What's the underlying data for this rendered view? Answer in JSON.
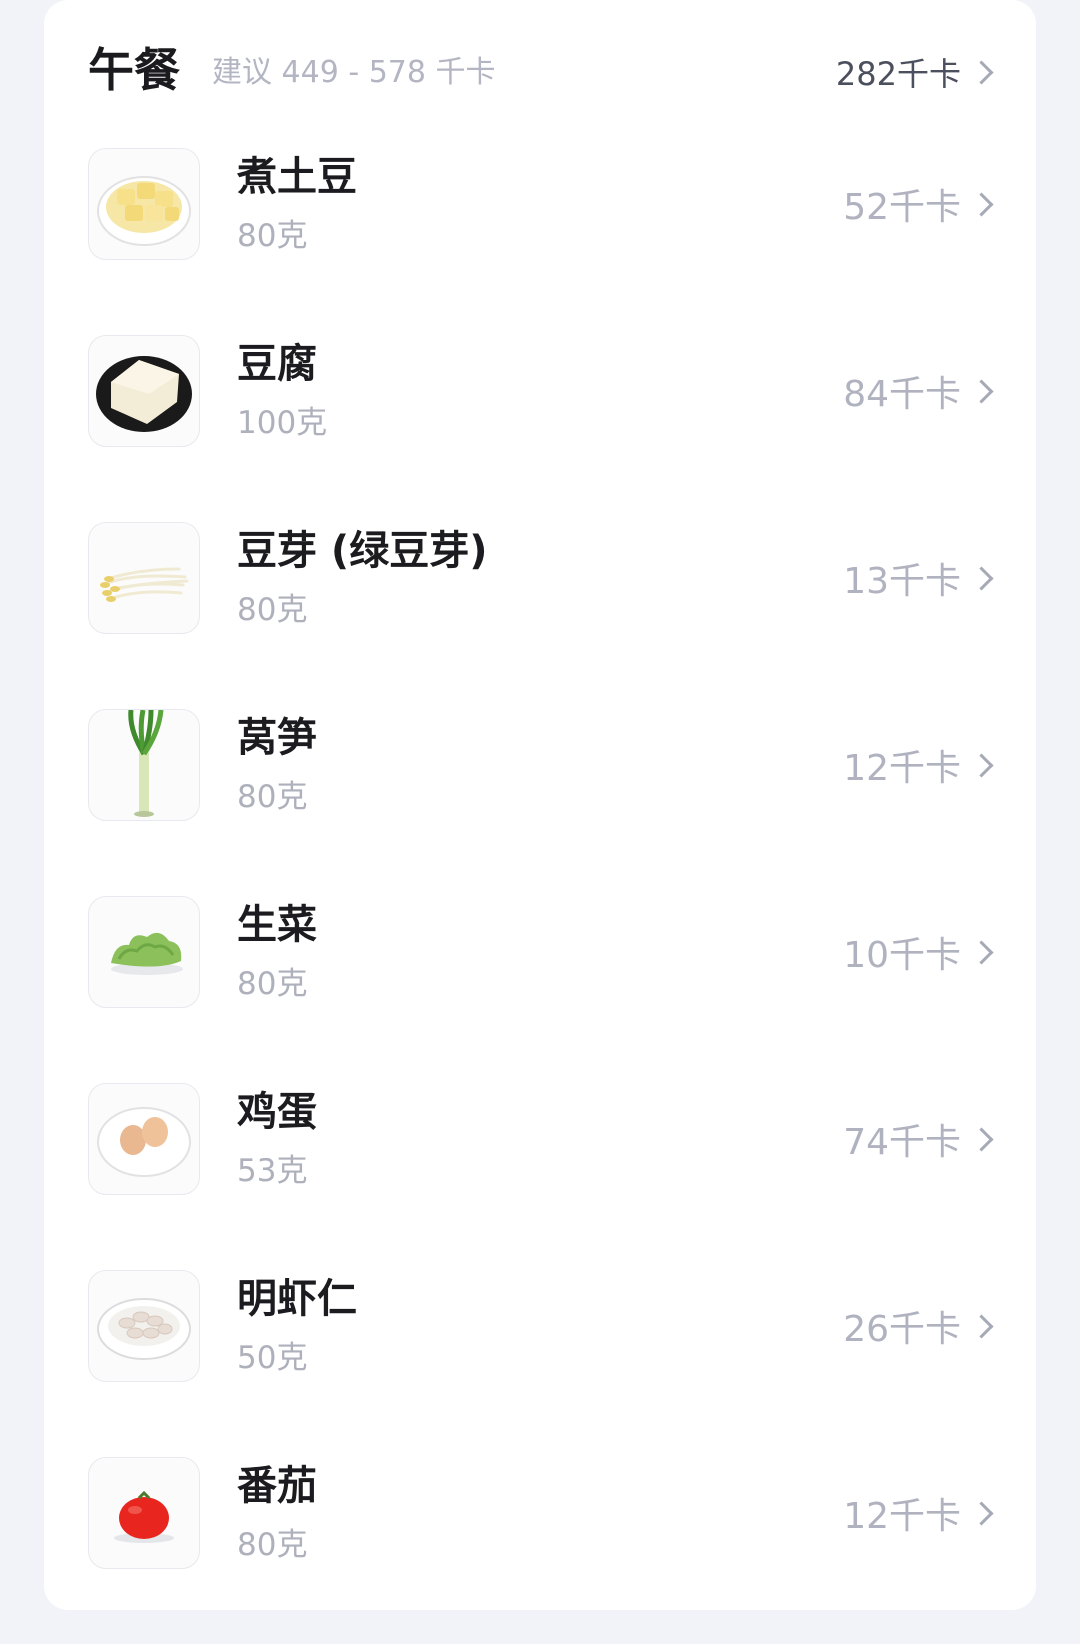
{
  "meal": {
    "title": "午餐",
    "suggestion": "建议 449 - 578 千卡",
    "total_kcal": "282千卡"
  },
  "items": [
    {
      "name": "煮土豆",
      "weight": "80克",
      "kcal": "52千卡",
      "icon": "boiled-potato-icon"
    },
    {
      "name": "豆腐",
      "weight": "100克",
      "kcal": "84千卡",
      "icon": "tofu-icon"
    },
    {
      "name": "豆芽 (绿豆芽)",
      "weight": "80克",
      "kcal": "13千卡",
      "icon": "bean-sprouts-icon"
    },
    {
      "name": "莴笋",
      "weight": "80克",
      "kcal": "12千卡",
      "icon": "celtuce-icon"
    },
    {
      "name": "生菜",
      "weight": "80克",
      "kcal": "10千卡",
      "icon": "lettuce-icon"
    },
    {
      "name": "鸡蛋",
      "weight": "53克",
      "kcal": "74千卡",
      "icon": "eggs-icon"
    },
    {
      "name": "明虾仁",
      "weight": "50克",
      "kcal": "26千卡",
      "icon": "shrimp-icon"
    },
    {
      "name": "番茄",
      "weight": "80克",
      "kcal": "12千卡",
      "icon": "tomato-icon"
    }
  ],
  "colors": {
    "background": "#f2f3f8",
    "card": "#ffffff",
    "title": "#1b1b1f",
    "muted": "#b0b3bf",
    "total": "#4c4f5d"
  }
}
